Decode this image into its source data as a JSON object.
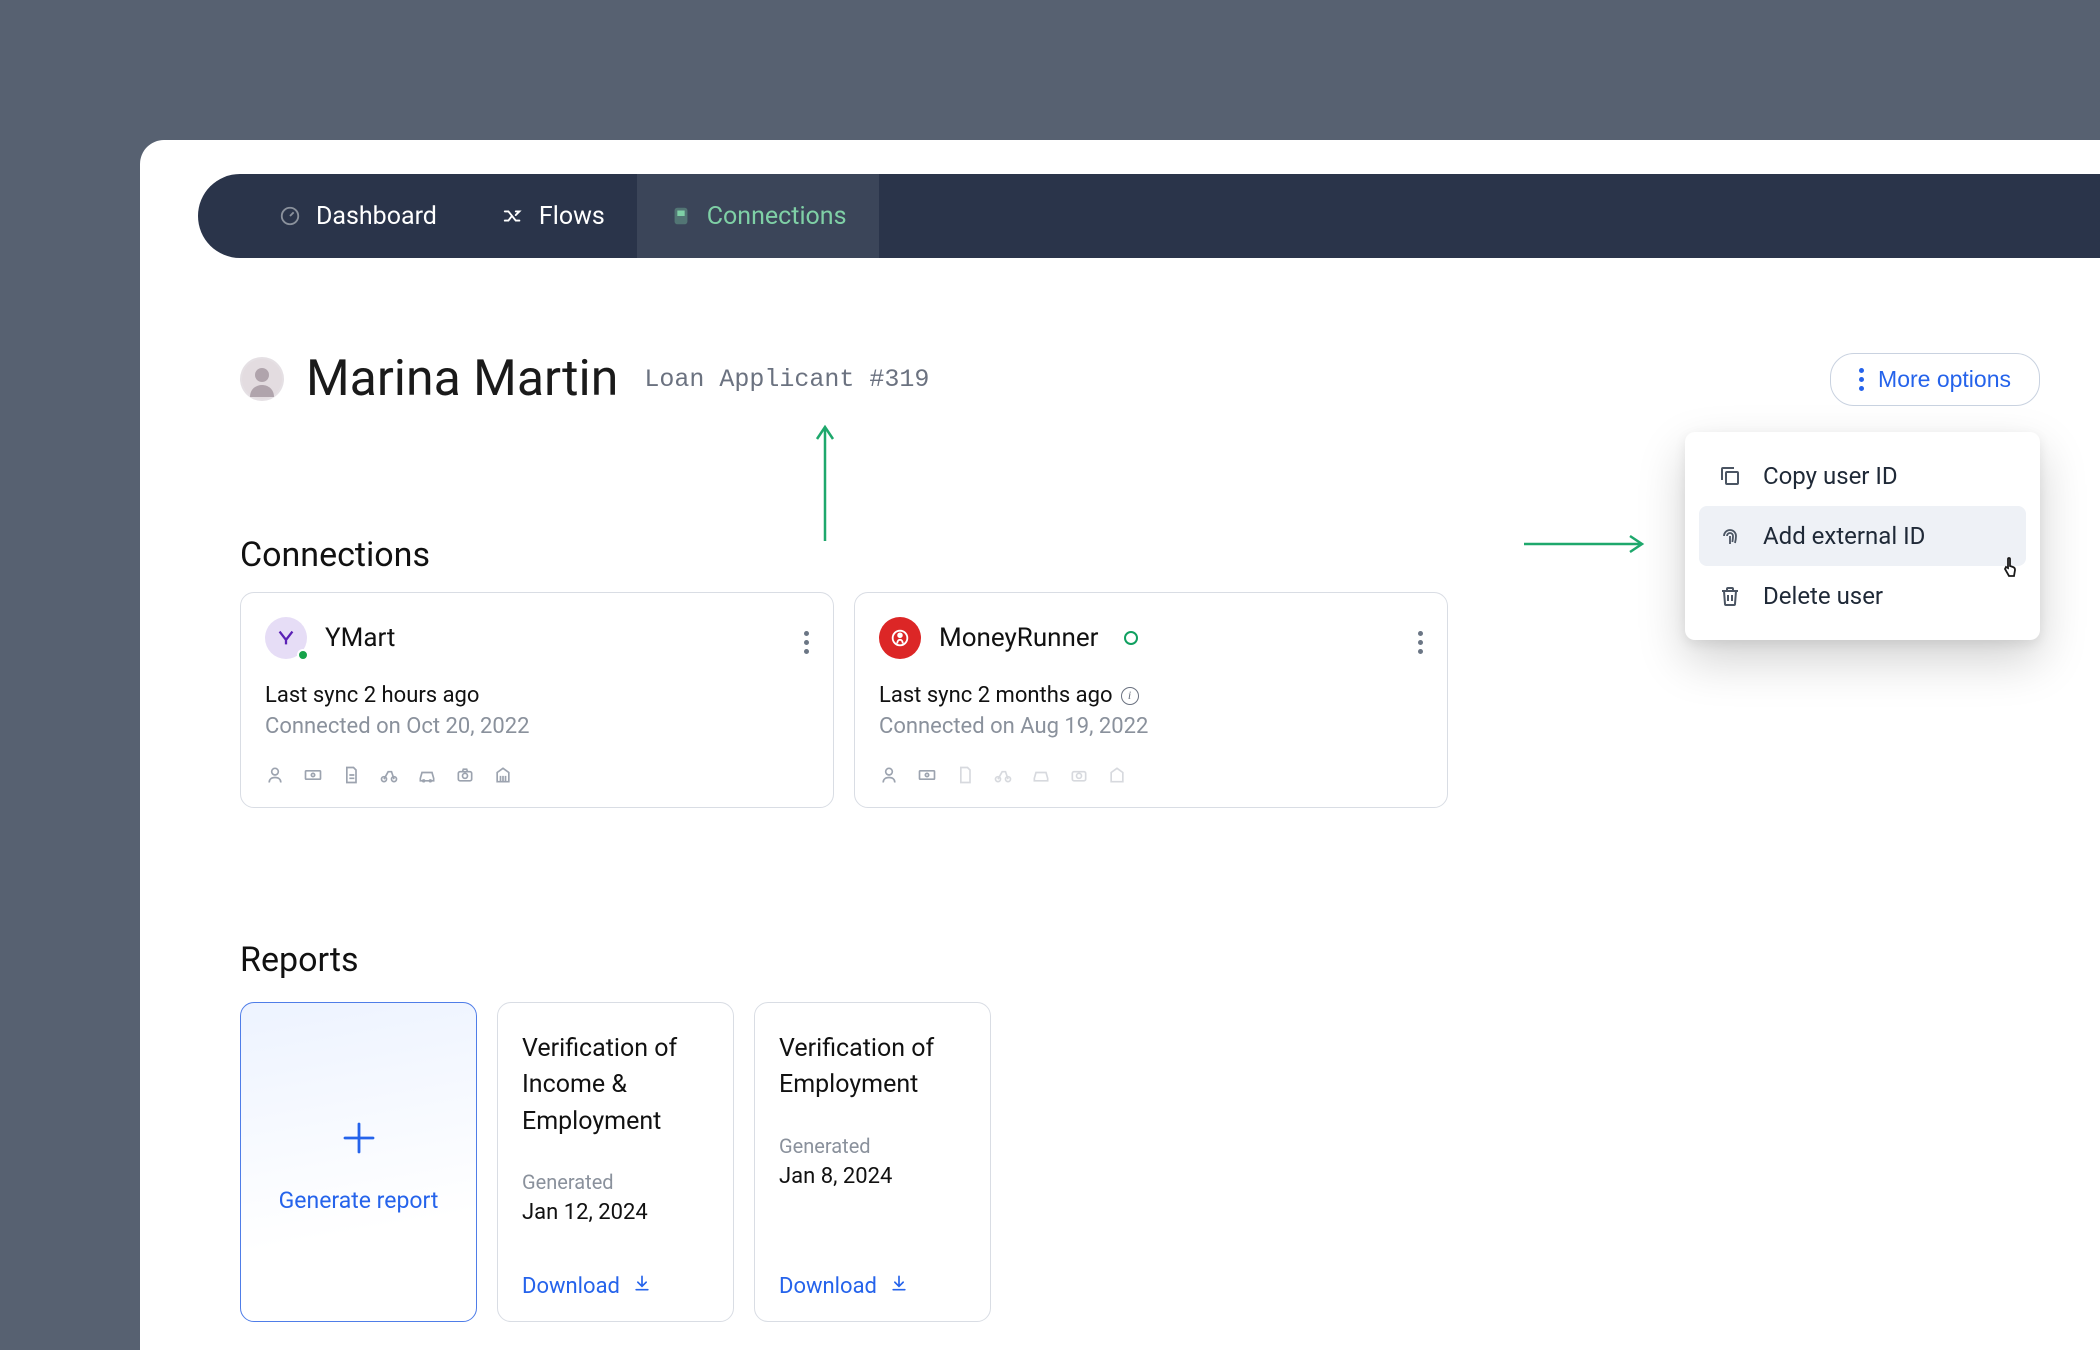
{
  "nav": {
    "items": [
      {
        "label": "Dashboard",
        "active": false
      },
      {
        "label": "Flows",
        "active": false
      },
      {
        "label": "Connections",
        "active": true
      }
    ]
  },
  "header": {
    "name": "Marina Martin",
    "subtitle": "Loan Applicant #319",
    "more_options_label": "More options"
  },
  "dropdown": {
    "items": [
      {
        "label": "Copy user ID",
        "icon": "copy-icon"
      },
      {
        "label": "Add external ID",
        "icon": "fingerprint-icon",
        "hovered": true
      },
      {
        "label": "Delete user",
        "icon": "trash-icon"
      }
    ]
  },
  "sections": {
    "connections_title": "Connections",
    "reports_title": "Reports"
  },
  "connections": [
    {
      "name": "YMart",
      "last_sync": "Last sync 2 hours ago",
      "connected_on": "Connected on Oct 20, 2022",
      "has_info_icon": false,
      "all_icons_active": true,
      "status_indicator": "dot"
    },
    {
      "name": "MoneyRunner",
      "last_sync": "Last sync 2 months ago",
      "connected_on": "Connected on Aug 19, 2022",
      "has_info_icon": true,
      "all_icons_active": false,
      "status_indicator": "hollow"
    }
  ],
  "reports": {
    "generate_label": "Generate report",
    "generated_text": "Generated",
    "download_label": "Download",
    "cards": [
      {
        "title": "Verification of Income & Employment",
        "date": "Jan 12, 2024"
      },
      {
        "title": "Verification of Employment",
        "date": "Jan 8, 2024"
      }
    ]
  }
}
